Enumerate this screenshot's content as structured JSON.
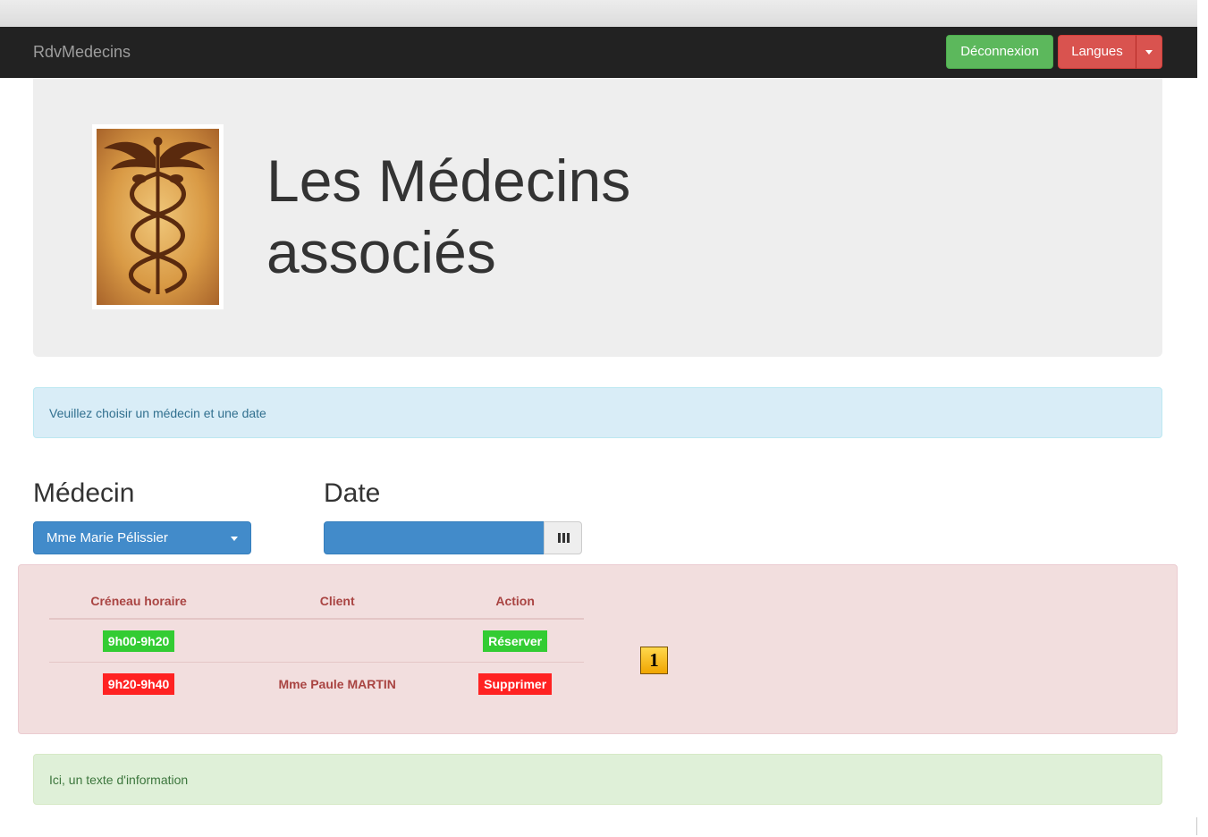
{
  "navbar": {
    "brand": "RdvMedecins",
    "logout_label": "Déconnexion",
    "languages_label": "Langues"
  },
  "jumbotron": {
    "title_line1": "Les Médecins",
    "title_line2": "associés",
    "logo_icon": "caduceus-icon"
  },
  "info_alert": "Veuillez choisir un médecin et une date",
  "form": {
    "doctor_label": "Médecin",
    "doctor_selected": "Mme Marie Pélissier",
    "date_label": "Date",
    "date_value": "",
    "calendar_icon": "calendar-grid-icon"
  },
  "slots": {
    "headers": [
      "Créneau horaire",
      "Client",
      "Action"
    ],
    "rows": [
      {
        "slot": "9h00-9h20",
        "client": "",
        "action": "Réserver",
        "status_color": "#33cc33"
      },
      {
        "slot": "9h20-9h40",
        "client": "Mme Paule MARTIN",
        "action": "Supprimer",
        "status_color": "#ff2222"
      }
    ]
  },
  "marker_label": "1",
  "success_alert": "Ici, un texte d'information",
  "colors": {
    "navbar": "#222222",
    "success": "#5cb85c",
    "danger": "#d9534f",
    "primary": "#428bca"
  }
}
